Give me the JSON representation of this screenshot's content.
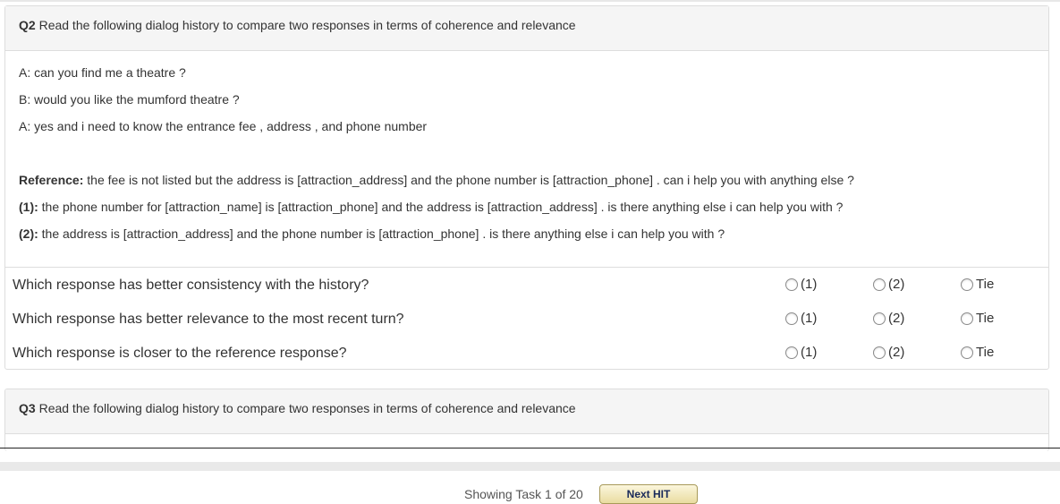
{
  "q2": {
    "number": "Q2",
    "instruction": "Read the following dialog history to compare two responses in terms of coherence and relevance",
    "history": [
      "A: can you find me a theatre ?",
      "B: would you like the mumford theatre ?",
      "A: yes and i need to know the entrance fee , address , and phone number"
    ],
    "reference_label": "Reference:",
    "reference_text": "the fee is not listed but the address is [attraction_address] and the phone number is [attraction_phone] . can i help you with anything else ?",
    "resp1_label": "(1):",
    "resp1_text": "the phone number for [attraction_name] is [attraction_phone] and the address is [attraction_address] . is there anything else i can help you with ?",
    "resp2_label": "(2):",
    "resp2_text": "the address is [attraction_address] and the phone number is [attraction_phone] . is there anything else i can help you with ?",
    "questions": [
      "Which response has better consistency with the history?",
      "Which response has better relevance to the most recent turn?",
      "Which response is closer to the reference response?"
    ],
    "options": [
      "(1)",
      "(2)",
      "Tie"
    ]
  },
  "q3": {
    "number": "Q3",
    "instruction": "Read the following dialog history to compare two responses in terms of coherence and relevance"
  },
  "footer": {
    "showing": "Showing Task 1 of 20",
    "next_label": "Next HIT"
  }
}
